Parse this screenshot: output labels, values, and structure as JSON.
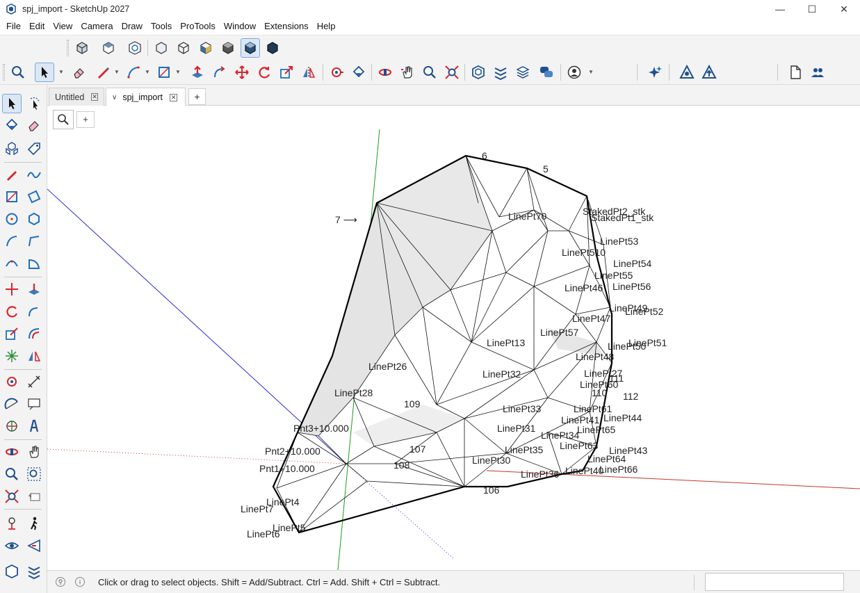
{
  "window": {
    "title": "spj_import - SketchUp 2027",
    "minimize": "—",
    "maximize": "☐",
    "close": "✕"
  },
  "menu": [
    "File",
    "Edit",
    "View",
    "Camera",
    "Draw",
    "Tools",
    "ProTools",
    "Window",
    "Extensions",
    "Help"
  ],
  "tabs": [
    {
      "label": "Untitled",
      "active": false
    },
    {
      "label": "spj_import",
      "active": true
    }
  ],
  "tab_add": "+",
  "viewport_add": "+",
  "status": {
    "message": "Click or drag to select objects. Shift = Add/Subtract. Ctrl = Add. Shift + Ctrl = Subtract.",
    "measurements_value": ""
  },
  "colors": {
    "x_axis": "#c0392b",
    "y_axis": "#1a9e1a",
    "z_axis": "#2b2bd6",
    "accent_blue": "#1e6fbf",
    "toolbar_bg": "#f3f3f3"
  },
  "scene_labels": [
    {
      "text": "6"
    },
    {
      "text": "5"
    },
    {
      "text": "7 ⟶"
    },
    {
      "text": "StakedPt2_stk"
    },
    {
      "text": "StakedPt1_stk"
    },
    {
      "text": "LinePt70"
    },
    {
      "text": "LinePt53"
    },
    {
      "text": "LinePt510"
    },
    {
      "text": "LinePt54"
    },
    {
      "text": "LinePt55"
    },
    {
      "text": "LinePt56"
    },
    {
      "text": "LinePt46"
    },
    {
      "text": "LinePt49"
    },
    {
      "text": "LinePt52"
    },
    {
      "text": "LinePt47"
    },
    {
      "text": "LinePt57"
    },
    {
      "text": "LinePt13"
    },
    {
      "text": "LinePt51"
    },
    {
      "text": "LinePt50"
    },
    {
      "text": "LinePt48"
    },
    {
      "text": "LinePt26"
    },
    {
      "text": "LinePt32"
    },
    {
      "text": "LinePt27"
    },
    {
      "text": "111"
    },
    {
      "text": "LinePt60"
    },
    {
      "text": "110"
    },
    {
      "text": "112"
    },
    {
      "text": "LinePt28"
    },
    {
      "text": "109"
    },
    {
      "text": "LinePt33"
    },
    {
      "text": "LinePt61"
    },
    {
      "text": "LinePt44"
    },
    {
      "text": "LinePt41"
    },
    {
      "text": "LinePt65"
    },
    {
      "text": "Pnt3+10.000"
    },
    {
      "text": "LinePt31"
    },
    {
      "text": "LinePt34"
    },
    {
      "text": "107"
    },
    {
      "text": "LinePt35"
    },
    {
      "text": "LinePt63"
    },
    {
      "text": "LinePt43"
    },
    {
      "text": "Pnt2+10.000"
    },
    {
      "text": "Pnt1+10.000"
    },
    {
      "text": "108"
    },
    {
      "text": "LinePt30"
    },
    {
      "text": "LinePt64"
    },
    {
      "text": "LinePt40"
    },
    {
      "text": "LinePt66"
    },
    {
      "text": "LinePt36"
    },
    {
      "text": "106"
    },
    {
      "text": "LinePt4"
    },
    {
      "text": "LinePt7"
    },
    {
      "text": "LinePt5"
    },
    {
      "text": "LinePt6"
    }
  ]
}
